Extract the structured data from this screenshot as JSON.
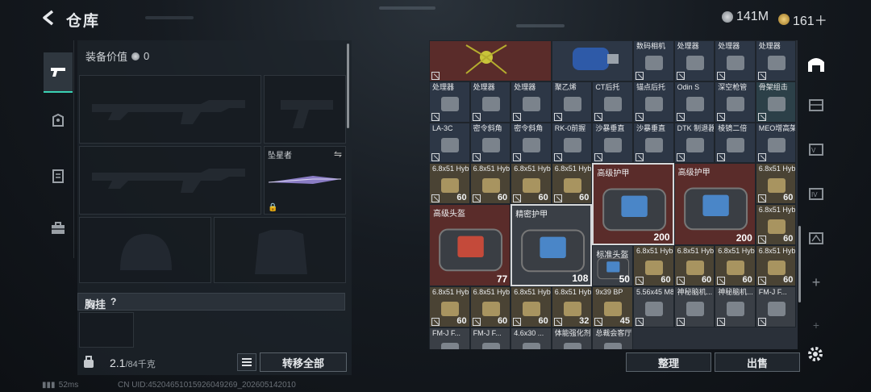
{
  "header": {
    "title": "仓库",
    "currency_silver": "141M",
    "currency_gold": "161＋"
  },
  "equipment": {
    "value_label": "装备价值",
    "value": "0",
    "melee_label": "坠星者",
    "chest_label": "胸挂",
    "chest_help": "?",
    "weight_value": "2.1",
    "weight_max": "/84千克",
    "transfer_all": "转移全部"
  },
  "inventory": {
    "cells": [
      {
        "nm": "",
        "cnt": "",
        "bg": "red"
      },
      {
        "nm": "",
        "cnt": "",
        "bg": "blue"
      },
      {
        "nm": "数码相机",
        "cnt": "",
        "bg": "blue"
      },
      {
        "nm": "处理器",
        "cnt": "",
        "bg": "blue"
      },
      {
        "nm": "处理器",
        "cnt": "",
        "bg": "blue"
      },
      {
        "nm": "处理器",
        "cnt": "",
        "bg": "blue"
      },
      {
        "nm": "处理器",
        "cnt": "",
        "bg": "blue"
      },
      {
        "nm": "处理器",
        "cnt": "",
        "bg": "blue"
      },
      {
        "nm": "处理器",
        "cnt": "",
        "bg": "blue"
      },
      {
        "nm": "聚乙烯",
        "cnt": "",
        "bg": "blue"
      },
      {
        "nm": "CT后托",
        "cnt": "",
        "bg": "blue"
      },
      {
        "nm": "锚点后托",
        "cnt": "",
        "bg": "blue"
      },
      {
        "nm": "Odin S",
        "cnt": "",
        "bg": "blue"
      },
      {
        "nm": "深空枪管",
        "cnt": "",
        "bg": "blue"
      },
      {
        "nm": "骨架组击",
        "cnt": "",
        "bg": "teal"
      },
      {
        "nm": "LA-3C",
        "cnt": "",
        "bg": "blue"
      },
      {
        "nm": "密令斜角",
        "cnt": "",
        "bg": "blue"
      },
      {
        "nm": "密令斜角",
        "cnt": "",
        "bg": "blue"
      },
      {
        "nm": "RK-0前握",
        "cnt": "",
        "bg": "blue"
      },
      {
        "nm": "沙暴垂直",
        "cnt": "",
        "bg": "blue"
      },
      {
        "nm": "沙暴垂直",
        "cnt": "",
        "bg": "blue"
      },
      {
        "nm": "DTK 制退器",
        "cnt": "",
        "bg": "blue"
      },
      {
        "nm": "棱镜二倍",
        "cnt": "",
        "bg": "blue"
      },
      {
        "nm": "MEO增高架",
        "cnt": "",
        "bg": "blue"
      },
      {
        "nm": "6.8x51 Hybrid",
        "cnt": "60",
        "bg": "tan"
      },
      {
        "nm": "6.8x51 Hybrid",
        "cnt": "60",
        "bg": "tan"
      },
      {
        "nm": "6.8x51 Hybrid",
        "cnt": "60",
        "bg": "tan"
      },
      {
        "nm": "6.8x51 Hybrid",
        "cnt": "60",
        "bg": "tan"
      },
      {
        "nm": "6.8x51 Hybrid",
        "cnt": "60",
        "bg": "tan"
      },
      {
        "nm": "6.8x51 Hybrid",
        "cnt": "60",
        "bg": "tan"
      },
      {
        "nm": "6.8x51 Hybrid",
        "cnt": "60",
        "bg": "tan"
      },
      {
        "nm": "6.8x51 Hybrid",
        "cnt": "60",
        "bg": "tan"
      },
      {
        "nm": "6.8x51 Hybrid",
        "cnt": "60",
        "bg": "tan"
      },
      {
        "nm": "6.8x51 Hybrid",
        "cnt": "60",
        "bg": "tan"
      },
      {
        "nm": "6.8x51 Hybrid",
        "cnt": "60",
        "bg": "tan"
      },
      {
        "nm": "6.8x51 Hybrid",
        "cnt": "60",
        "bg": "tan"
      },
      {
        "nm": "6.8x51 Hybrid",
        "cnt": "60",
        "bg": "tan"
      },
      {
        "nm": "6.8x51 Hybrid",
        "cnt": "32",
        "bg": "tan"
      },
      {
        "nm": "9x39 BP",
        "cnt": "45",
        "bg": "tan"
      },
      {
        "nm": "5.56x45 M855",
        "cnt": "",
        "bg": "gray"
      },
      {
        "nm": "神秘脑机...",
        "cnt": "",
        "bg": "gray"
      },
      {
        "nm": "神秘脑机...",
        "cnt": "",
        "bg": "gray"
      },
      {
        "nm": "FM-J F...",
        "cnt": "",
        "bg": "gray"
      },
      {
        "nm": "FM-J F...",
        "cnt": "",
        "bg": "gray"
      },
      {
        "nm": "FM-J F...",
        "cnt": "",
        "bg": "gray"
      },
      {
        "nm": "4.6x30 ...",
        "cnt": "",
        "bg": "gray"
      },
      {
        "nm": "体能强化剂",
        "cnt": "",
        "bg": "gray"
      },
      {
        "nm": "总裁会客厅",
        "cnt": "",
        "bg": "gray"
      }
    ],
    "big": [
      {
        "nm": "高级护甲",
        "dur": "200"
      },
      {
        "nm": "高级护甲",
        "dur": "200"
      },
      {
        "nm": "高级头盔",
        "dur": "77"
      },
      {
        "nm": "精密护甲",
        "dur": "108"
      },
      {
        "nm": "标准头盔",
        "dur": "50"
      }
    ]
  },
  "actions": {
    "sort": "整理",
    "sell": "出售"
  },
  "footer": {
    "ping": "52ms",
    "uid": "CN UID:4520465101592604926​9_202605142010"
  }
}
